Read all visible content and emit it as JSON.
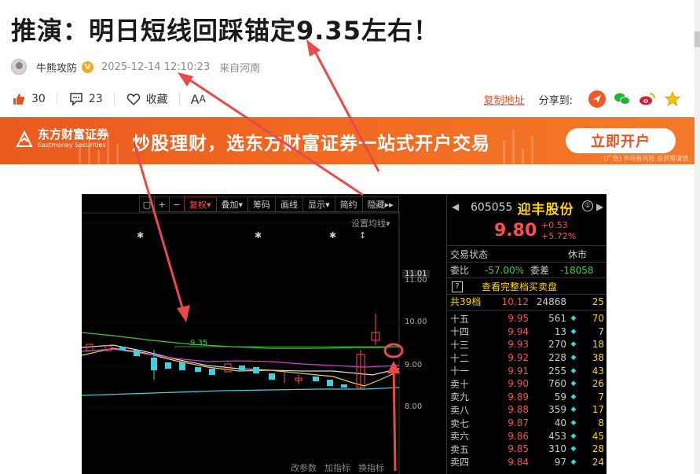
{
  "article": {
    "title": "推演：明日短线回踩锚定9.35左右！",
    "author": "牛熊攻防",
    "verified_badge": "V",
    "date": "2025-12-14 12:10:23",
    "location": "来自河南"
  },
  "actions": {
    "like_count": "30",
    "comment_count": "23",
    "favorite_label": "收藏",
    "font_size_label_big": "A",
    "font_size_label_small": "A"
  },
  "share": {
    "copy_label": "复制地址",
    "share_to_label": "分享到:",
    "targets": [
      "toutiao-icon",
      "wechat-icon",
      "weibo-icon",
      "star-icon"
    ]
  },
  "banner": {
    "brand_cn": "东方财富证券",
    "brand_en": "Eastmoney Securities",
    "slogan": "炒股理财，选东方财富证券一站式开户交易",
    "cta": "立即开户",
    "note": "[广告] 市场有风险 投资需谨慎"
  },
  "chart_toolbar": {
    "buttons": [
      "复权",
      "叠加",
      "筹码",
      "画线",
      "显示",
      "简约",
      "隐藏"
    ],
    "set_ma": "设置均线"
  },
  "chart_labels": {
    "highlight_price": "11.01",
    "prices": [
      "11.00",
      "10.00",
      "9.00",
      "8.00"
    ],
    "anchor": "9.35",
    "bottom_links": [
      "改参数",
      "加指标",
      "换指标"
    ]
  },
  "quote": {
    "code": "605055",
    "name": "迎丰股份",
    "price": "9.80",
    "change": "+0.53",
    "change_pct": "+5.72%",
    "status_label": "交易状态",
    "status_value": "休市",
    "weibi_label": "委比",
    "weibi_value": "-57.00%",
    "weicha_label": "委差",
    "weicha_value": "-18058",
    "help_badge": "?",
    "full_depth_label": "查看完整档买卖盘",
    "levels_label": "共39档",
    "levels_price": "10.12",
    "levels_vol": "24868",
    "levels_add": "25"
  },
  "orderbook": [
    {
      "label": "十五",
      "price": "9.95",
      "vol": "561",
      "dia": "◆",
      "add": "70"
    },
    {
      "label": "十四",
      "price": "9.94",
      "vol": "13",
      "dia": "◆",
      "add": "7"
    },
    {
      "label": "十三",
      "price": "9.93",
      "vol": "270",
      "dia": "◆",
      "add": "18"
    },
    {
      "label": "十二",
      "price": "9.92",
      "vol": "228",
      "dia": "◆",
      "add": "38"
    },
    {
      "label": "十一",
      "price": "9.91",
      "vol": "255",
      "dia": "◆",
      "add": "43"
    },
    {
      "label": "卖十",
      "price": "9.90",
      "vol": "760",
      "dia": "◆",
      "add": "26"
    },
    {
      "label": "卖九",
      "price": "9.89",
      "vol": "59",
      "dia": "◆",
      "add": "7"
    },
    {
      "label": "卖八",
      "price": "9.88",
      "vol": "359",
      "dia": "◆",
      "add": "17"
    },
    {
      "label": "卖七",
      "price": "9.87",
      "vol": "40",
      "dia": "◆",
      "add": "8"
    },
    {
      "label": "卖六",
      "price": "9.86",
      "vol": "453",
      "dia": "◆",
      "add": "45"
    },
    {
      "label": "卖五",
      "price": "9.85",
      "vol": "310",
      "dia": "◆",
      "add": "28"
    },
    {
      "label": "卖四",
      "price": "9.84",
      "vol": "97",
      "dia": "◆",
      "add": "24"
    }
  ],
  "colors": {
    "accent": "#e8531f",
    "price_up": "#ff4d4d",
    "name_yellow": "#ffd400",
    "annotation_red": "#e84a4a"
  }
}
